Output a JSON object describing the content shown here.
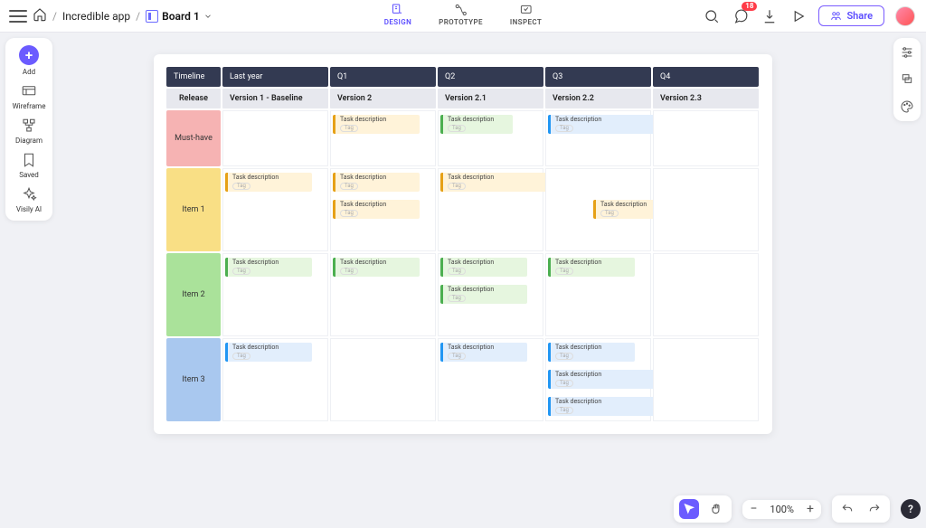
{
  "breadcrumb": {
    "parent": "Incredible app",
    "board": "Board 1"
  },
  "modes": {
    "design": "DESIGN",
    "prototype": "PROTOTYPE",
    "inspect": "INSPECT"
  },
  "notifications": {
    "count": "18"
  },
  "share": {
    "label": "Share"
  },
  "sidebar": {
    "add": "Add",
    "wireframe": "Wireframe",
    "diagram": "Diagram",
    "saved": "Saved",
    "ai": "Visily AI"
  },
  "board": {
    "headers": [
      "Timeline",
      "Last year",
      "Q1",
      "Q2",
      "Q3",
      "Q4"
    ],
    "release_row": [
      "Release",
      "Version 1 - Baseline",
      "Version 2",
      "Version 2.1",
      "Version 2.2",
      "Version 2.3"
    ],
    "rows": [
      "Must-have",
      "Item 1",
      "Item 2",
      "Item 3"
    ],
    "task_label": "Task description",
    "tag_label": "Tag"
  },
  "zoom": {
    "level": "100%"
  },
  "help": {
    "label": "?"
  }
}
